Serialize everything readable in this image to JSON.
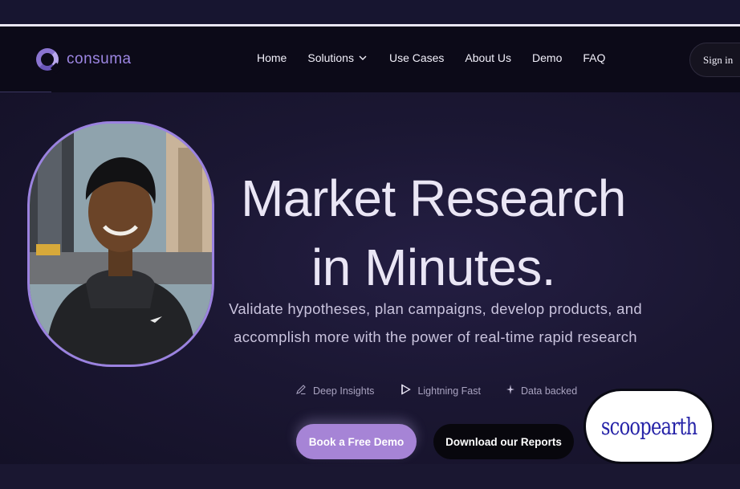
{
  "brand": {
    "name": "consuma",
    "accent": "#9d86e3"
  },
  "nav": {
    "items": [
      {
        "label": "Home"
      },
      {
        "label": "Solutions"
      },
      {
        "label": "Use Cases"
      },
      {
        "label": "About Us"
      },
      {
        "label": "Demo"
      },
      {
        "label": "FAQ"
      }
    ],
    "signin_label": "Sign in"
  },
  "hero": {
    "headline_line1": "Market Research",
    "headline_line2": "in Minutes.",
    "sub_line1": "Validate hypotheses, plan campaigns, develop products, and",
    "sub_line2": "accomplish more with the power of real-time rapid research",
    "features": [
      {
        "icon": "pencil-icon",
        "label": "Deep Insights"
      },
      {
        "icon": "play-icon",
        "label": "Lightning Fast"
      },
      {
        "icon": "sparkle-icon",
        "label": "Data backed"
      }
    ],
    "cta_primary": "Book a Free Demo",
    "cta_secondary": "Download our Reports",
    "primary_color": "#a684d6"
  },
  "badge": {
    "text": "scoopearth",
    "color": "#2623a8"
  }
}
